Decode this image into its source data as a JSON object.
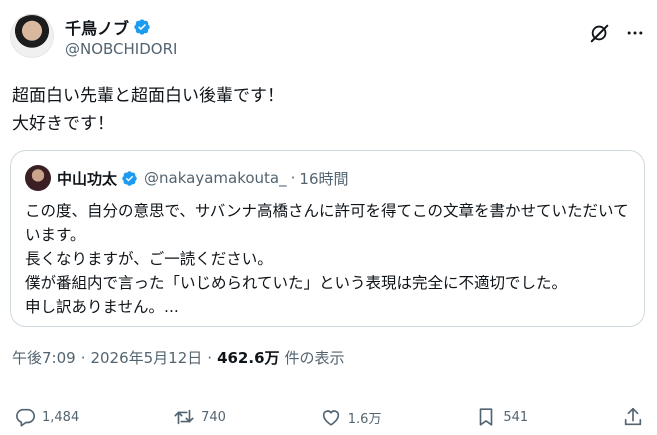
{
  "author": {
    "display_name": "千鳥ノブ",
    "handle": "@NOBCHIDORI"
  },
  "post": {
    "text": "超面白い先輩と超面白い後輩です！\n大好きです！"
  },
  "quoted": {
    "display_name": "中山功太",
    "handle": "@nakayamakouta_",
    "separator": "·",
    "time": "16時間",
    "text": "この度、自分の意思で、サバンナ高橋さんに許可を得てこの文章を書かせていただいています。\n長くなりますが、ご一読ください。\n僕が番組内で言った「いじめられていた」という表現は完全に不適切でした。\n申し訳ありません。..."
  },
  "meta": {
    "time": "午後7:09",
    "separator_1": "·",
    "date": "2026年5月12日",
    "separator_2": "·",
    "views": "462.6万",
    "views_label": "件の表示"
  },
  "actions": {
    "replies": "1,484",
    "reposts": "740",
    "likes": "1.6万",
    "bookmarks": "541"
  },
  "colors": {
    "verified": "#1d9bf0",
    "muted": "#536471",
    "text": "#0f1419",
    "border": "#cfd9de"
  },
  "icons": [
    "verified-badge-icon",
    "grok-icon",
    "more-icon",
    "reply-icon",
    "repost-icon",
    "like-icon",
    "bookmark-icon",
    "share-icon"
  ]
}
